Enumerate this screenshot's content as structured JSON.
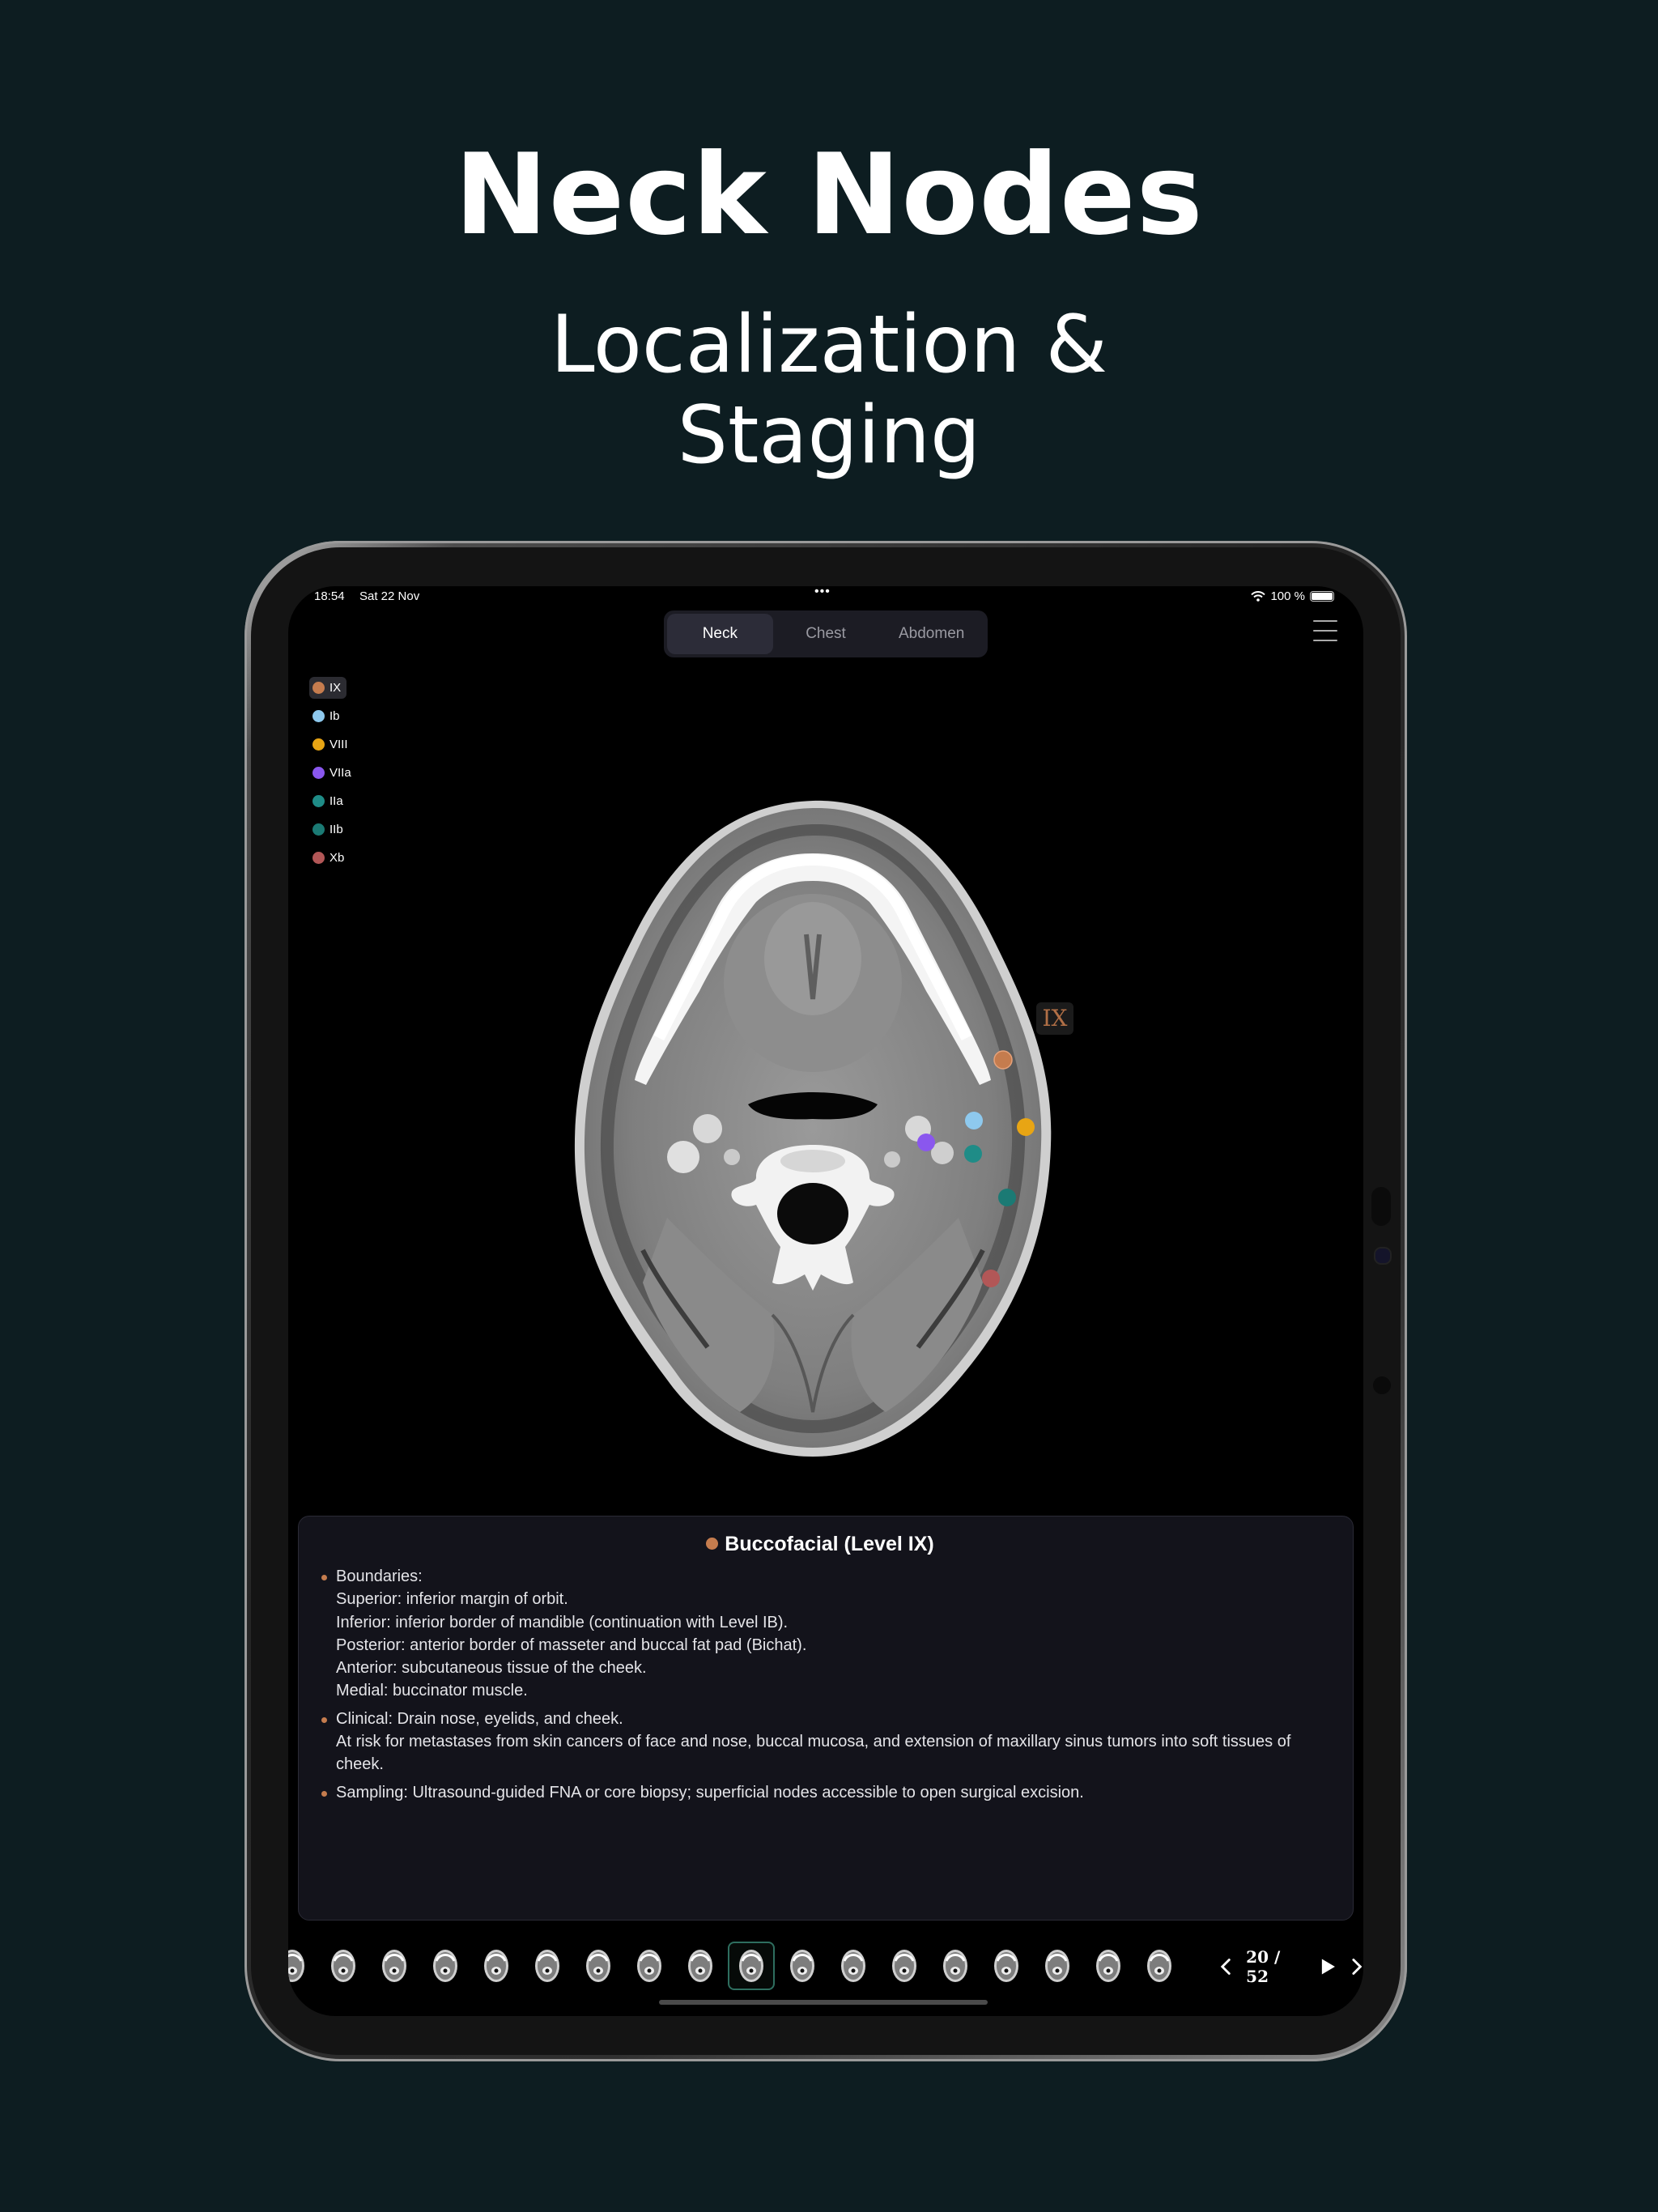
{
  "headline": {
    "title": "Neck Nodes",
    "subtitle_line1": "Localization &",
    "subtitle_line2": "Staging"
  },
  "status_bar": {
    "time": "18:54",
    "date": "Sat 22 Nov",
    "battery": "100 %"
  },
  "tabs": [
    {
      "label": "Neck",
      "active": true
    },
    {
      "label": "Chest",
      "active": false
    },
    {
      "label": "Abdomen",
      "active": false
    }
  ],
  "legend": [
    {
      "label": "IX",
      "color": "#c57c4e",
      "active": true
    },
    {
      "label": "Ib",
      "color": "#8ec9ee",
      "active": false
    },
    {
      "label": "VIII",
      "color": "#e8a514",
      "active": false
    },
    {
      "label": "VIIa",
      "color": "#8a57ee",
      "active": false
    },
    {
      "label": "IIa",
      "color": "#1f8c87",
      "active": false
    },
    {
      "label": "IIb",
      "color": "#1b7a74",
      "active": false
    },
    {
      "label": "Xb",
      "color": "#b25757",
      "active": false
    }
  ],
  "scan_label": "IX",
  "panel": {
    "title": "Buccofacial (Level IX)",
    "bullets": [
      {
        "lines": [
          "Boundaries:",
          "Superior: inferior margin of orbit.",
          "Inferior: inferior border of mandible (continuation with Level IB).",
          "Posterior: anterior border of masseter and buccal fat pad (Bichat).",
          "Anterior: subcutaneous tissue of the cheek.",
          "Medial: buccinator muscle."
        ]
      },
      {
        "lines": [
          "Clinical: Drain nose, eyelids, and cheek.",
          "At risk for metastases from skin cancers of face and nose, buccal mucosa, and extension of maxillary sinus tumors into soft tissues of cheek."
        ]
      },
      {
        "lines": [
          "Sampling: Ultrasound-guided FNA or core biopsy; superficial nodes accessible to open surgical excision."
        ]
      }
    ]
  },
  "pager": {
    "text": "20 / 52",
    "current": 20,
    "total": 52
  },
  "icons": [
    "wifi-icon",
    "battery-icon",
    "menu-icon",
    "chevron-left-icon",
    "play-icon",
    "chevron-right-icon"
  ]
}
